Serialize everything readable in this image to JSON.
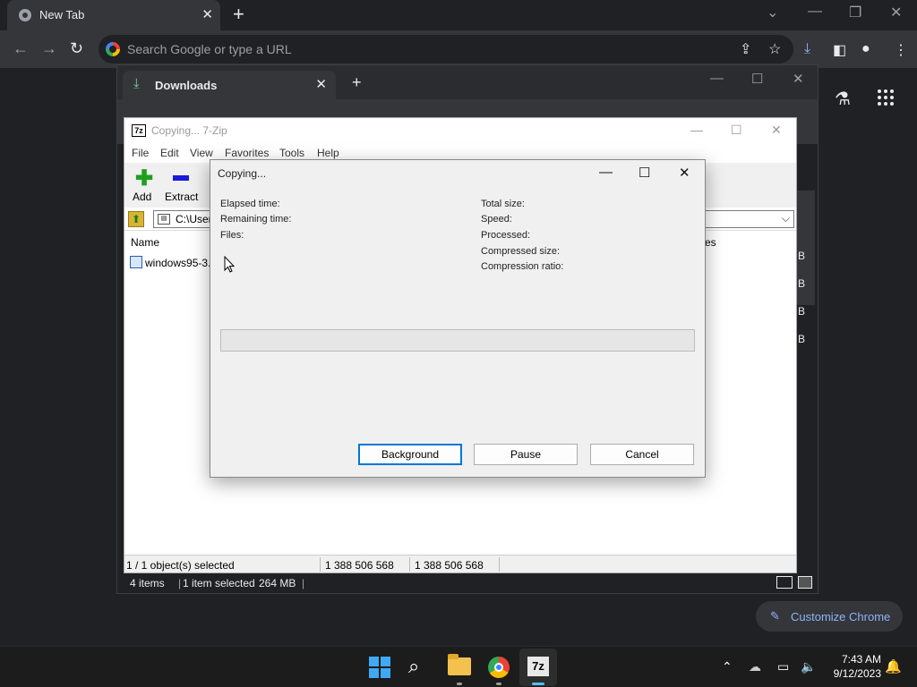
{
  "chrome": {
    "tab_title": "New Tab",
    "omnibox_placeholder": "Search Google or type a URL",
    "customize_label": "Customize Chrome"
  },
  "downloads_window": {
    "tab_title": "Downloads",
    "status_items": "4 items",
    "status_selected": "1 item selected",
    "status_size": "264 MB",
    "right_column_letters": [
      "B",
      "B",
      "B",
      "B"
    ],
    "partial_header": "es"
  },
  "zip": {
    "title": "Copying... 7-Zip",
    "menu": [
      "File",
      "Edit",
      "View",
      "Favorites",
      "Tools",
      "Help"
    ],
    "toolbar": {
      "add": "Add",
      "extract": "Extract"
    },
    "path": "C:\\User",
    "column_name": "Name",
    "file_name": "windows95-3.",
    "status": {
      "selected": "1 / 1 object(s) selected",
      "size1": "1 388 506 568",
      "size2": "1 388 506 568"
    }
  },
  "dialog": {
    "title": "Copying...",
    "left_labels": [
      "Elapsed time:",
      "Remaining time:",
      "Files:"
    ],
    "right_labels": [
      "Total size:",
      "Speed:",
      "Processed:",
      "Compressed size:",
      "Compression ratio:"
    ],
    "progress": 0,
    "buttons": {
      "background": "Background",
      "pause": "Pause",
      "cancel": "Cancel"
    }
  },
  "taskbar": {
    "time": "7:43 AM",
    "date": "9/12/2023"
  },
  "colors": {
    "accent": "#0078d7",
    "chrome_link": "#8ab4f8"
  }
}
